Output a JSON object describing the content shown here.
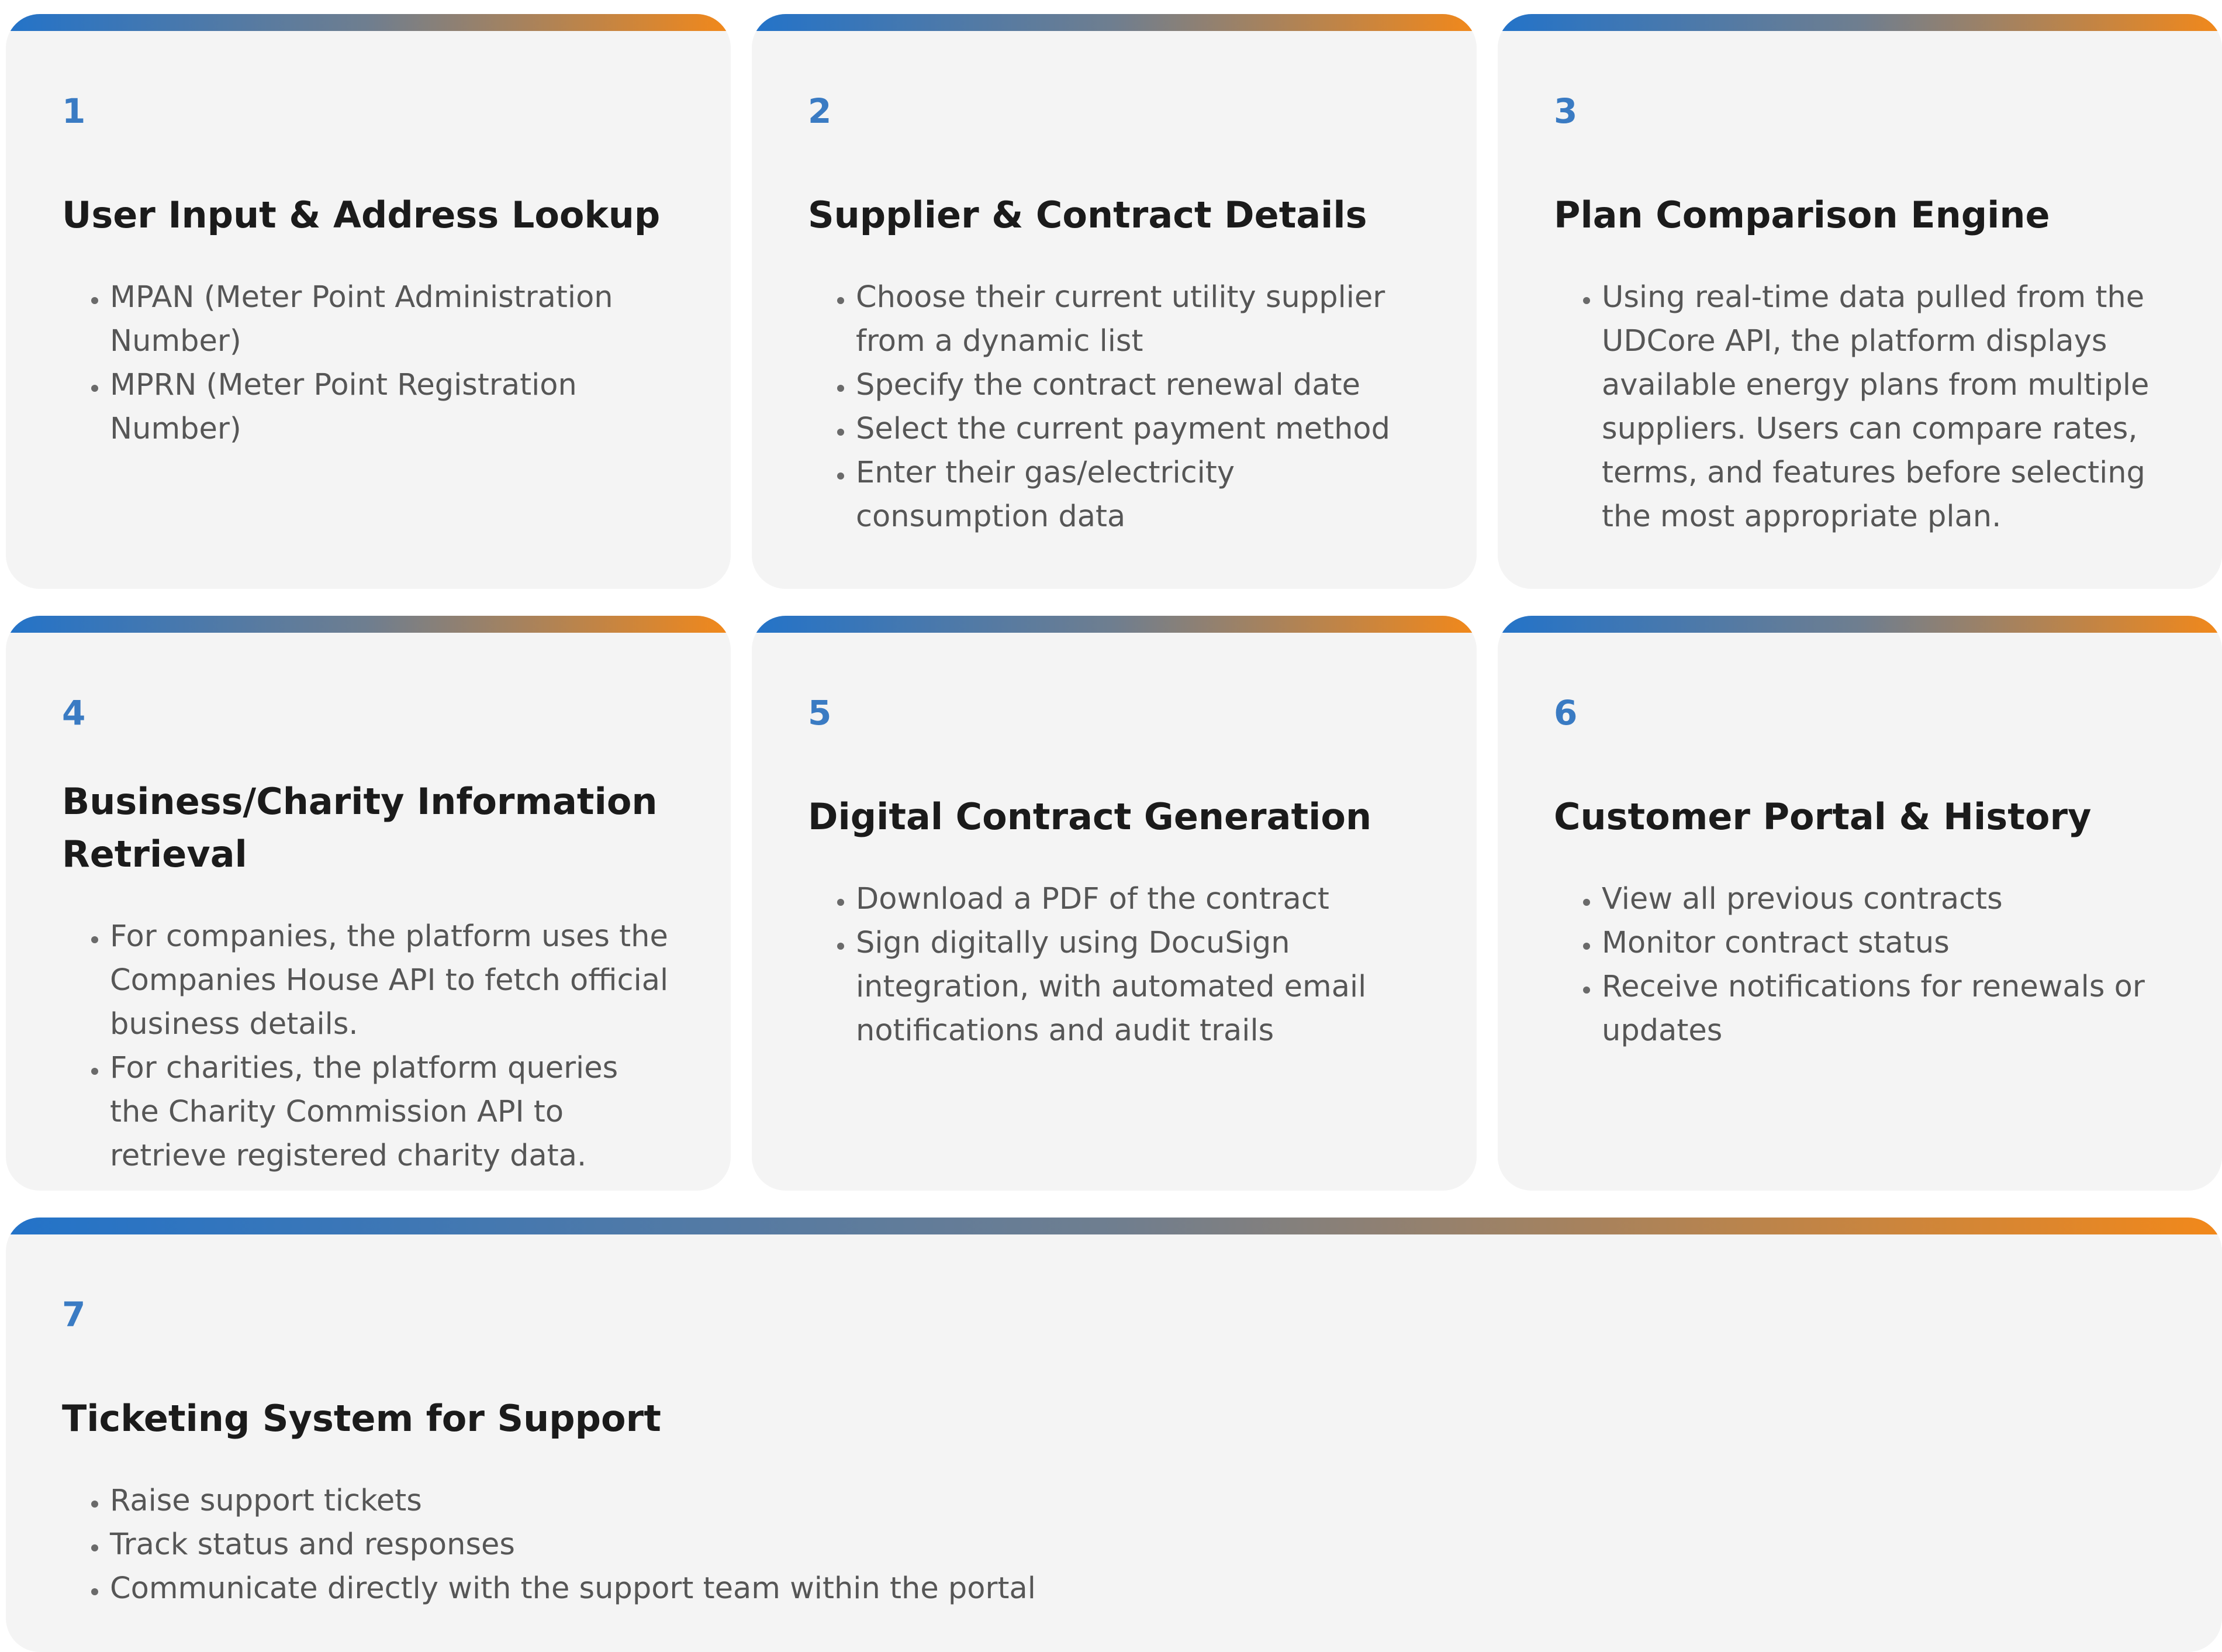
{
  "cards": [
    {
      "number": "1",
      "title": "User Input & Address Lookup",
      "items": [
        "MPAN (Meter Point Administration Number)",
        "MPRN (Meter Point Registration Number)"
      ]
    },
    {
      "number": "2",
      "title": "Supplier & Contract Details",
      "items": [
        "Choose their current utility supplier from a dynamic list",
        "Specify the contract renewal date",
        "Select the current payment method",
        "Enter their gas/electricity consumption data"
      ]
    },
    {
      "number": "3",
      "title": "Plan Comparison Engine",
      "items": [
        "Using real-time data pulled from the UDCore API, the platform displays available energy plans from multiple suppliers. Users can compare rates, terms, and features before selecting the most appropriate plan."
      ]
    },
    {
      "number": "4",
      "title": "Business/Charity Information Retrieval",
      "items": [
        "For companies, the platform uses the Companies House API to fetch official business details.",
        "For charities, the platform queries the Charity Commission API to retrieve registered charity data."
      ]
    },
    {
      "number": "5",
      "title": "Digital Contract Generation",
      "items": [
        "Download a PDF of the contract",
        "Sign digitally using DocuSign integration, with automated email notifications and audit trails"
      ]
    },
    {
      "number": "6",
      "title": "Customer Portal & History",
      "items": [
        "View all previous contracts",
        "Monitor contract status",
        "Receive notifications for renewals or updates"
      ]
    },
    {
      "number": "7",
      "title": "Ticketing System for Support",
      "items": [
        "Raise support tickets",
        "Track status and responses",
        "Communicate directly with the support team within the portal"
      ]
    }
  ],
  "colors": {
    "accent_blue": "#3a7bc3",
    "gradient_start": "#2373c9",
    "gradient_end": "#f2881a",
    "card_bg": "#f4f4f4",
    "title_text": "#1b1b1b",
    "body_text": "#565656"
  }
}
